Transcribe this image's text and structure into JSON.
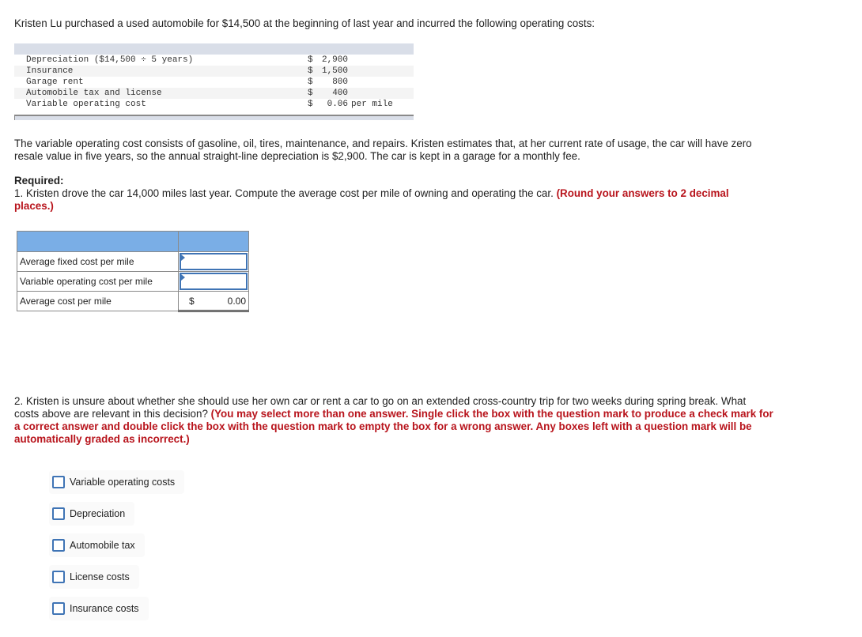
{
  "intro": "Kristen Lu purchased a used automobile for $14,500 at the beginning of last year and incurred the following operating costs:",
  "cost_table": {
    "rows": [
      {
        "label": "Depreciation ($14,500 ÷ 5 years)",
        "currency": "$",
        "amount": "2,900",
        "unit": ""
      },
      {
        "label": "Insurance",
        "currency": "$",
        "amount": "1,500",
        "unit": ""
      },
      {
        "label": "Garage rent",
        "currency": "$",
        "amount": "800",
        "unit": ""
      },
      {
        "label": "Automobile tax and license",
        "currency": "$",
        "amount": "400",
        "unit": ""
      },
      {
        "label": "Variable operating cost",
        "currency": "$",
        "amount": "0.06",
        "unit": "per mile"
      }
    ]
  },
  "description": "The variable operating cost consists of gasoline, oil, tires, maintenance, and repairs. Kristen estimates that, at her current rate of usage, the car will have zero resale value in five years, so the annual straight-line depreciation is $2,900. The car is kept in a garage for a monthly fee.",
  "required": {
    "heading": "Required:",
    "q1_text": "1. Kristen drove the car 14,000 miles last year. Compute the average cost per mile of owning and operating the car.",
    "q1_instruction": "(Round your answers to 2 decimal places.)",
    "q2_text": "2. Kristen is unsure about whether she should use her own car or rent a car to go on an extended cross-country trip for two weeks during spring break. What costs above are relevant in this decision?",
    "q2_instruction": "(You may select more than one answer. Single click the box with the question mark to produce a check mark for a correct answer and double click the box with the question mark to empty the box for a wrong answer. Any boxes left with a question mark will be automatically graded as incorrect.)"
  },
  "answer_table": {
    "rows": [
      {
        "label": "Average fixed cost per mile",
        "value": ""
      },
      {
        "label": "Variable operating cost per mile",
        "value": ""
      }
    ],
    "total": {
      "label": "Average cost per mile",
      "currency": "$",
      "value": "0.00"
    }
  },
  "options": [
    {
      "label": "Variable operating costs",
      "checked": false
    },
    {
      "label": "Depreciation",
      "checked": false
    },
    {
      "label": "Automobile tax",
      "checked": false
    },
    {
      "label": "License costs",
      "checked": false
    },
    {
      "label": "Insurance costs",
      "checked": false
    }
  ],
  "colors": {
    "accent_blue": "#3f74b5",
    "header_blue": "#7aaee6",
    "instruction_red": "#b8141c",
    "table_header_gray": "#d9dee8"
  }
}
